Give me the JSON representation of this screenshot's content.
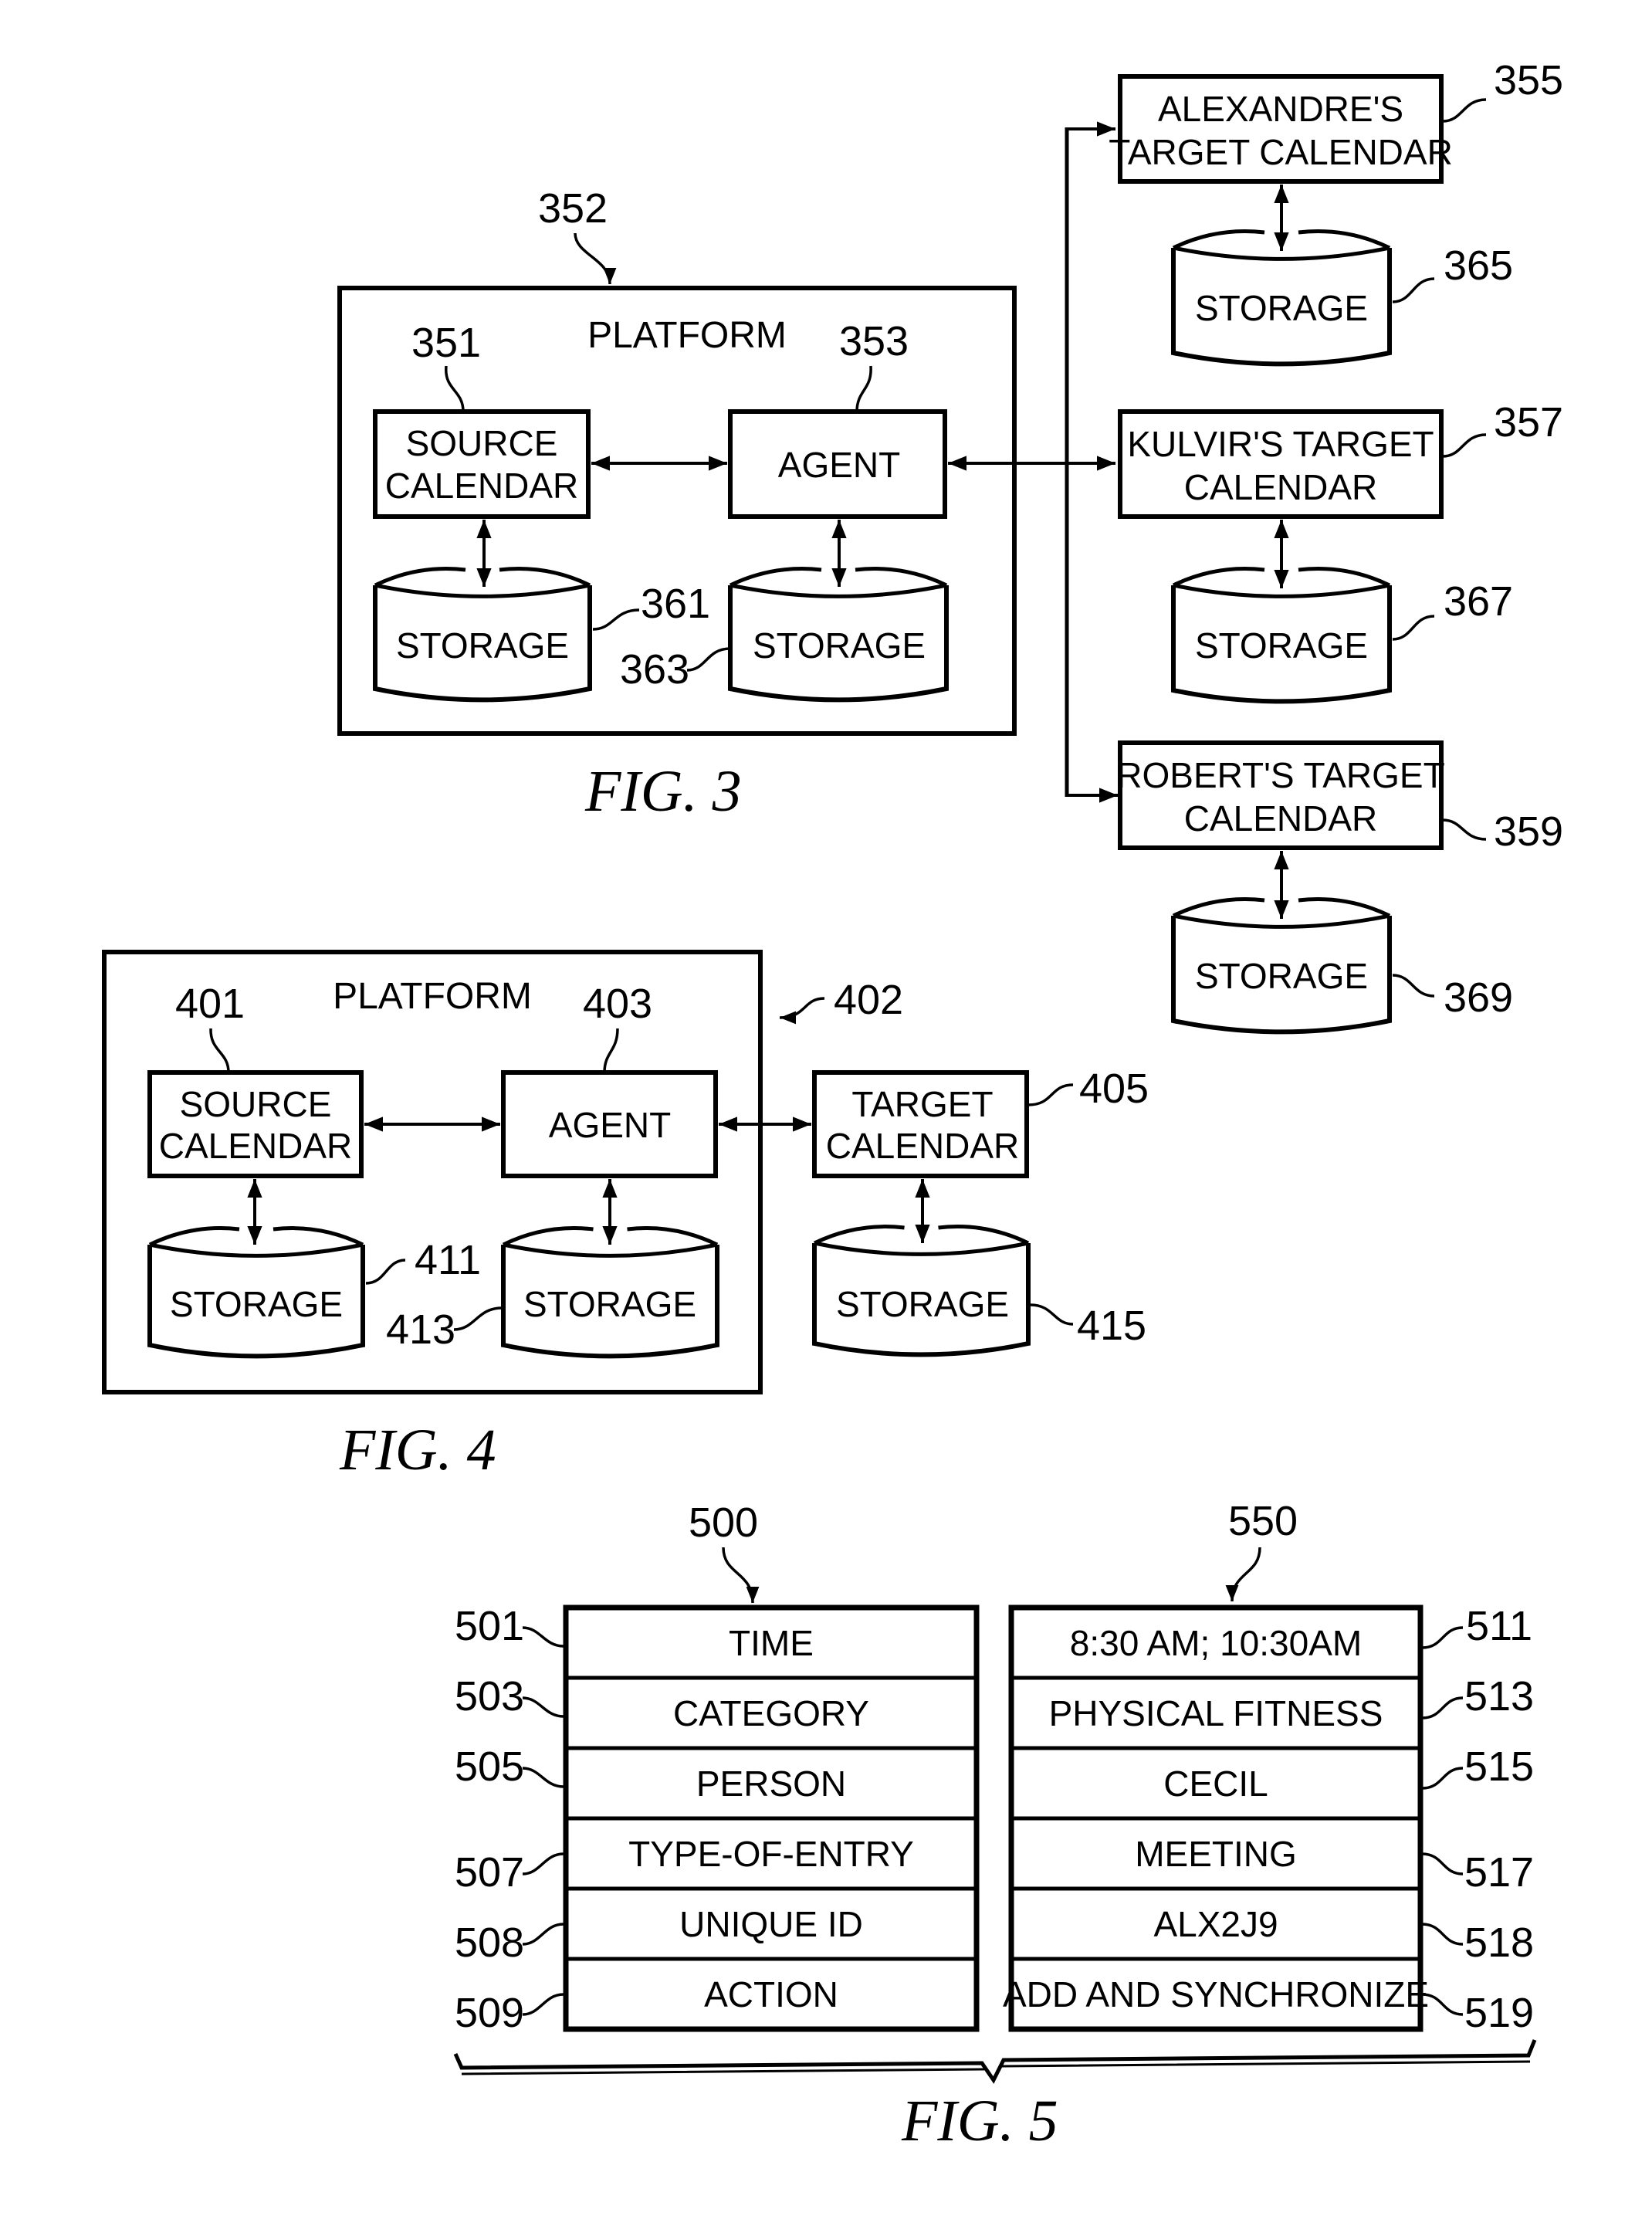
{
  "fig3": {
    "caption": "FIG. 3",
    "platform": {
      "title": "PLATFORM",
      "ref": "352"
    },
    "source_calendar": {
      "lines": [
        "SOURCE",
        "CALENDAR"
      ],
      "ref": "351"
    },
    "agent": {
      "lines": [
        "AGENT"
      ],
      "ref": "353"
    },
    "source_storage": {
      "label": "STORAGE",
      "ref": "361"
    },
    "agent_storage": {
      "label": "STORAGE",
      "ref": "363"
    },
    "targets": [
      {
        "lines": [
          "ALEXANDRE'S",
          "TARGET CALENDAR"
        ],
        "ref": "355",
        "storage_label": "STORAGE",
        "storage_ref": "365"
      },
      {
        "lines": [
          "KULVIR'S TARGET",
          "CALENDAR"
        ],
        "ref": "357",
        "storage_label": "STORAGE",
        "storage_ref": "367"
      },
      {
        "lines": [
          "ROBERT'S TARGET",
          "CALENDAR"
        ],
        "ref": "359",
        "storage_label": "STORAGE",
        "storage_ref": "369"
      }
    ]
  },
  "fig4": {
    "caption": "FIG. 4",
    "platform": {
      "title": "PLATFORM",
      "ref": "402"
    },
    "source_calendar": {
      "lines": [
        "SOURCE",
        "CALENDAR"
      ],
      "ref": "401"
    },
    "agent": {
      "lines": [
        "AGENT"
      ],
      "ref": "403"
    },
    "target_calendar": {
      "lines": [
        "TARGET",
        "CALENDAR"
      ],
      "ref": "405"
    },
    "source_storage": {
      "label": "STORAGE",
      "ref": "411"
    },
    "agent_storage": {
      "label": "STORAGE",
      "ref": "413"
    },
    "target_storage": {
      "label": "STORAGE",
      "ref": "415"
    }
  },
  "fig5": {
    "caption": "FIG. 5",
    "fields_table": {
      "ref": "500",
      "rows": [
        {
          "label": "TIME",
          "ref": "501"
        },
        {
          "label": "CATEGORY",
          "ref": "503"
        },
        {
          "label": "PERSON",
          "ref": "505"
        },
        {
          "label": "TYPE-OF-ENTRY",
          "ref": "507"
        },
        {
          "label": "UNIQUE ID",
          "ref": "508"
        },
        {
          "label": "ACTION",
          "ref": "509"
        }
      ]
    },
    "values_table": {
      "ref": "550",
      "rows": [
        {
          "label": "8:30 AM; 10:30AM",
          "ref": "511"
        },
        {
          "label": "PHYSICAL FITNESS",
          "ref": "513"
        },
        {
          "label": "CECIL",
          "ref": "515"
        },
        {
          "label": "MEETING",
          "ref": "517"
        },
        {
          "label": "ALX2J9",
          "ref": "518"
        },
        {
          "label": "ADD AND SYNCHRONIZE",
          "ref": "519"
        }
      ]
    }
  }
}
